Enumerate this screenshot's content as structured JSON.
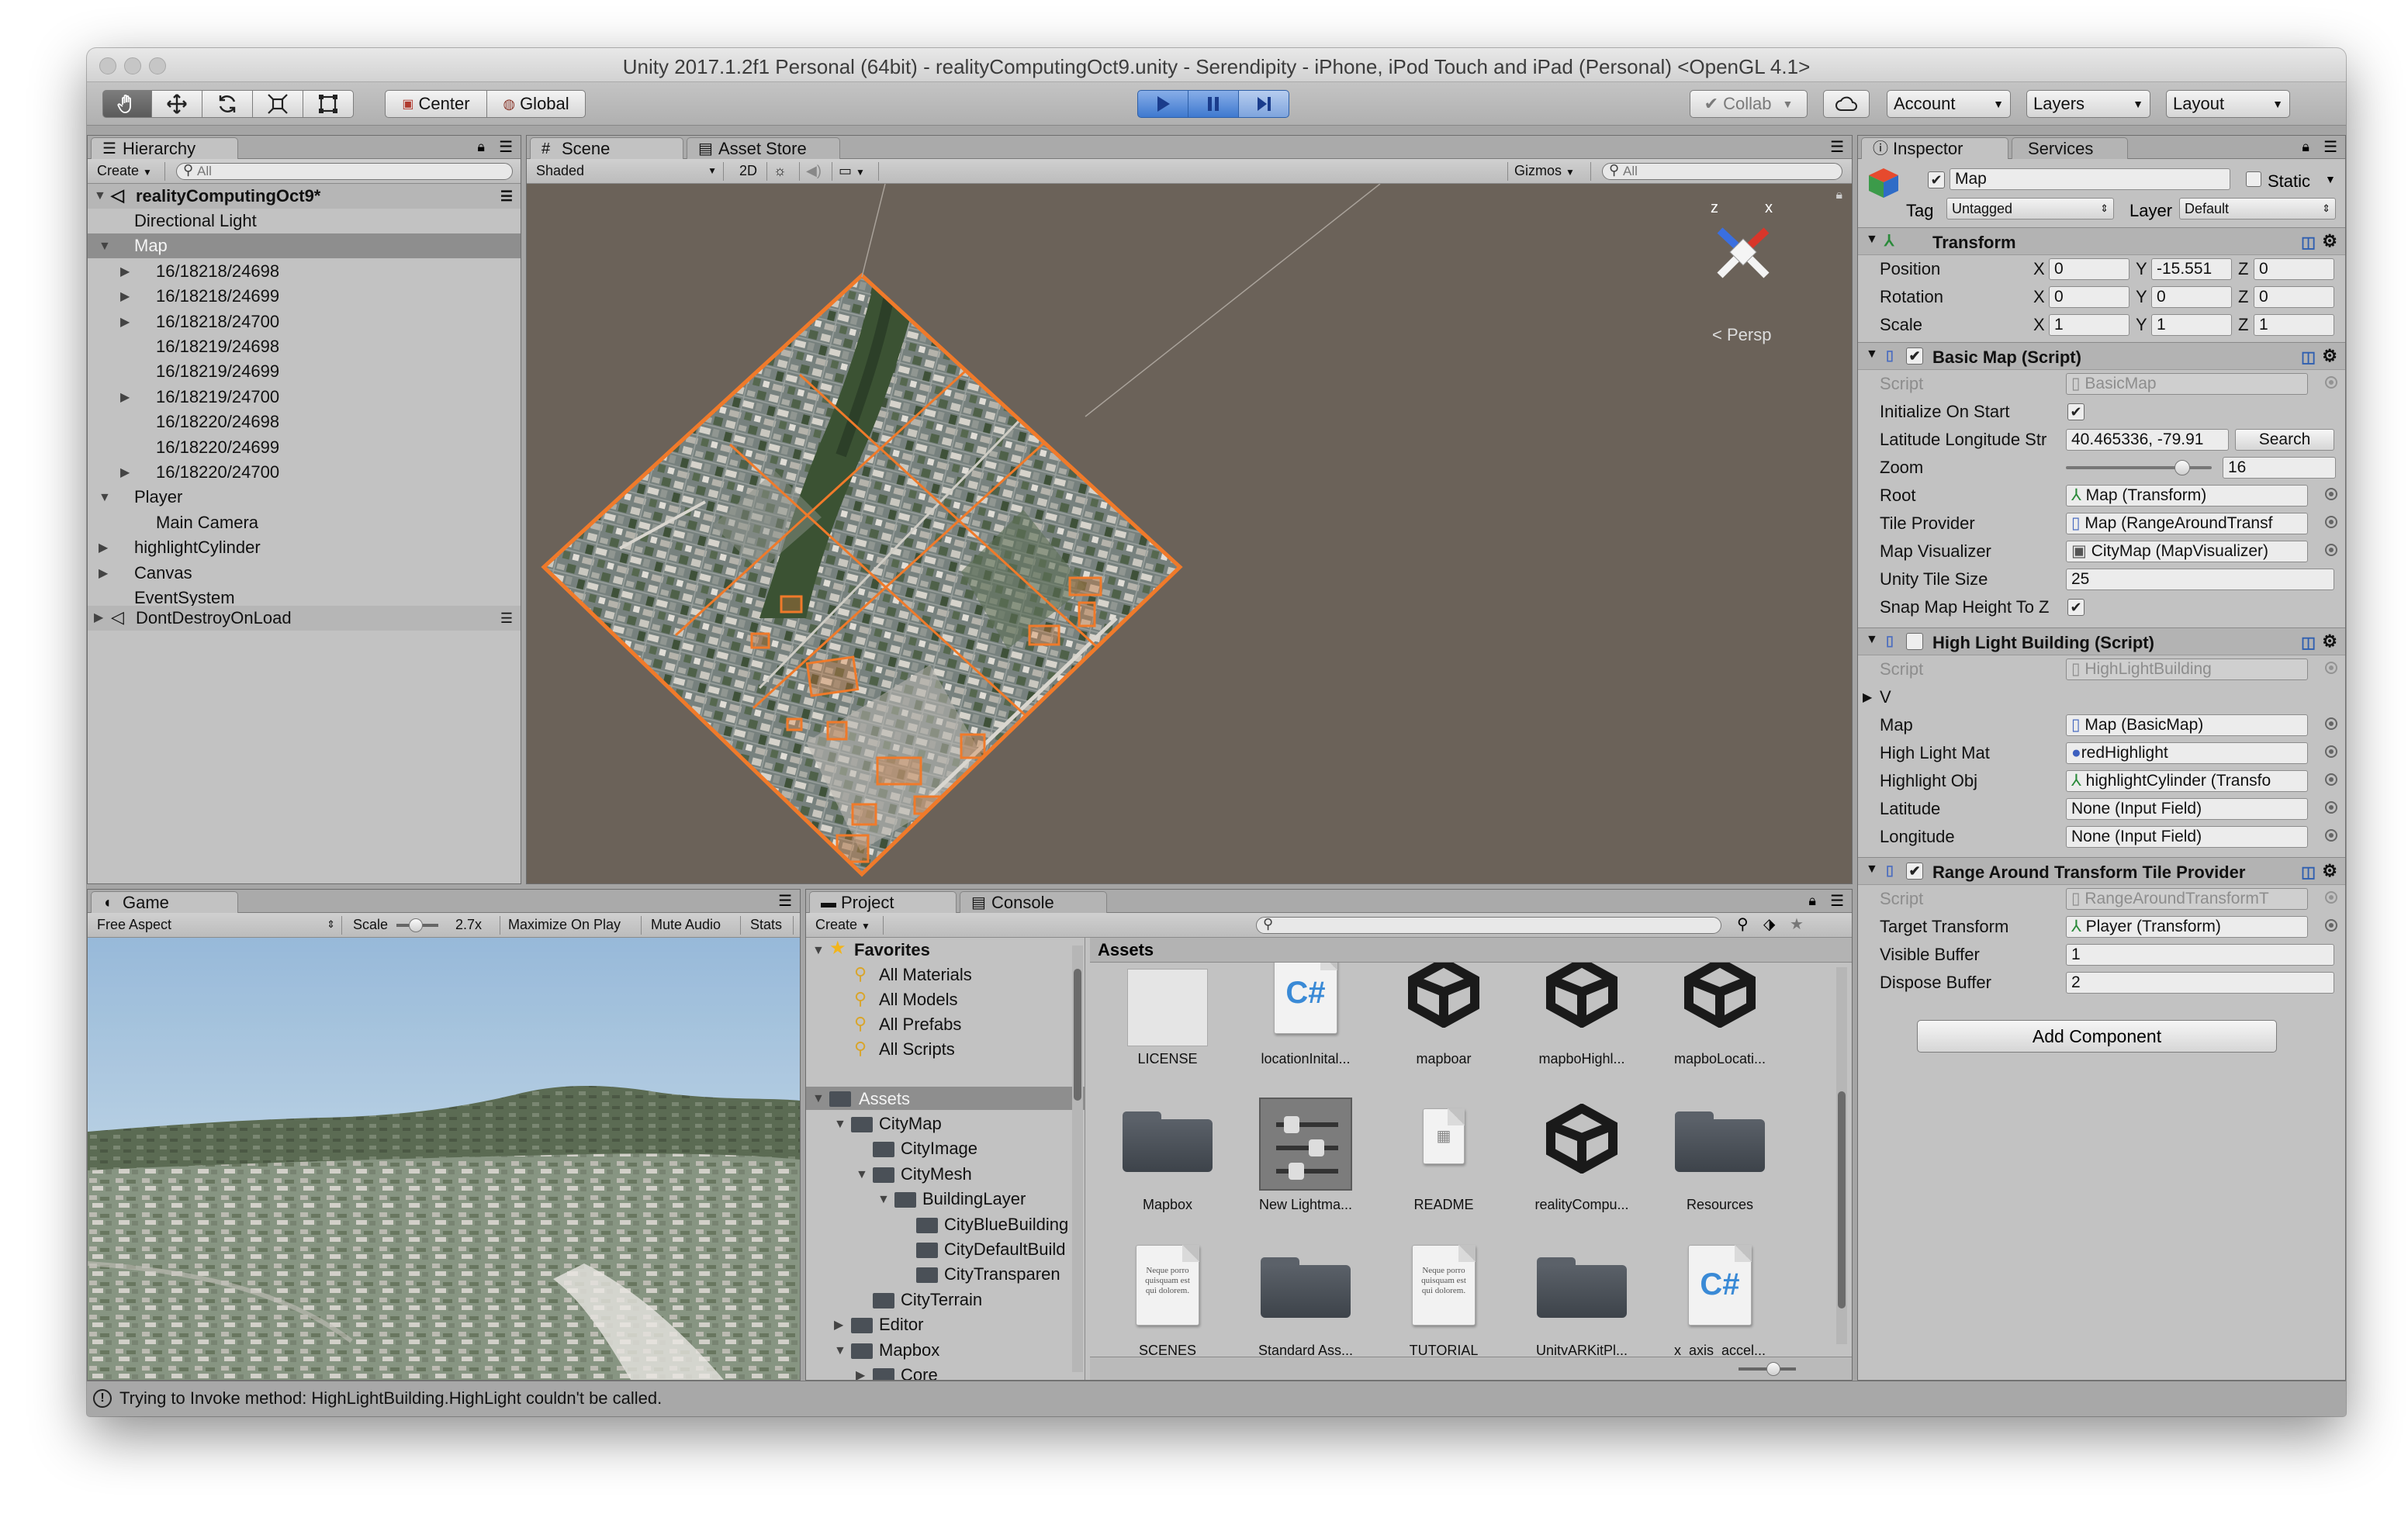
{
  "window": {
    "title": "Unity 2017.1.2f1 Personal (64bit) - realityComputingOct9.unity - Serendipity - iPhone, iPod Touch and iPad (Personal) <OpenGL 4.1>"
  },
  "toolbar": {
    "pivot_label": "Center",
    "rotation_label": "Global",
    "collab_label": "Collab",
    "account_label": "Account",
    "layers_label": "Layers",
    "layout_label": "Layout"
  },
  "hierarchy": {
    "tab_label": "Hierarchy",
    "create_label": "Create",
    "search_placeholder": "All",
    "scene_name": "realityComputingOct9*",
    "items": [
      {
        "label": "Directional Light"
      },
      {
        "label": "Map"
      },
      {
        "label": "16/18218/24698"
      },
      {
        "label": "16/18218/24699"
      },
      {
        "label": "16/18218/24700"
      },
      {
        "label": "16/18219/24698"
      },
      {
        "label": "16/18219/24699"
      },
      {
        "label": "16/18219/24700"
      },
      {
        "label": "16/18220/24698"
      },
      {
        "label": "16/18220/24699"
      },
      {
        "label": "16/18220/24700"
      },
      {
        "label": "Player"
      },
      {
        "label": "Main Camera"
      },
      {
        "label": "highlightCylinder"
      },
      {
        "label": "Canvas"
      },
      {
        "label": "EventSystem"
      }
    ],
    "ddol_label": "DontDestroyOnLoad"
  },
  "scene": {
    "tab_label": "Scene",
    "asset_store_label": "Asset Store",
    "shading_label": "Shaded",
    "mode_2d": "2D",
    "gizmos_label": "Gizmos",
    "search_placeholder": "All",
    "gizmo_x": "x",
    "gizmo_z": "z",
    "persp_label": "Persp"
  },
  "game": {
    "tab_label": "Game",
    "aspect_label": "Free Aspect",
    "scale_label": "Scale",
    "scale_value": "2.7x",
    "maximize_label": "Maximize On Play",
    "mute_label": "Mute Audio",
    "stats_label": "Stats"
  },
  "project": {
    "tab_label": "Project",
    "console_tab_label": "Console",
    "create_label": "Create",
    "favorites_label": "Favorites",
    "favorites": [
      "All Materials",
      "All Models",
      "All Prefabs",
      "All Scripts"
    ],
    "assets_label": "Assets",
    "tree": [
      "CityMap",
      "CityImage",
      "CityMesh",
      "BuildingLayer",
      "CityBlueBuilding",
      "CityDefaultBuild",
      "CityTransparen",
      "CityTerrain",
      "Editor",
      "Mapbox",
      "Core"
    ],
    "assets_header": "Assets",
    "assets": [
      {
        "label": "LICENSE",
        "kind": "doc"
      },
      {
        "label": "locationInital...",
        "kind": "script"
      },
      {
        "label": "mapboar",
        "kind": "unity"
      },
      {
        "label": "mapboHighl...",
        "kind": "unity"
      },
      {
        "label": "mapboLocati...",
        "kind": "unity"
      },
      {
        "label": "Mapbox",
        "kind": "folder"
      },
      {
        "label": "New Lightma...",
        "kind": "lightmap"
      },
      {
        "label": "README",
        "kind": "readme"
      },
      {
        "label": "realityCompu...",
        "kind": "unity"
      },
      {
        "label": "Resources",
        "kind": "folder"
      },
      {
        "label": "SCENES",
        "kind": "text"
      },
      {
        "label": "Standard Ass...",
        "kind": "folder"
      },
      {
        "label": "TUTORIAL",
        "kind": "text"
      },
      {
        "label": "UnityARKitPl...",
        "kind": "folder"
      },
      {
        "label": "x_axis_accel...",
        "kind": "script"
      }
    ],
    "doc_preview_text": "Neque porro quisquam est qui dolorem."
  },
  "inspector": {
    "tab_label": "Inspector",
    "services_label": "Services",
    "object_name": "Map",
    "static_label": "Static",
    "tag_label": "Tag",
    "tag_value": "Untagged",
    "layer_label": "Layer",
    "layer_value": "Default",
    "transform": {
      "title": "Transform",
      "position_label": "Position",
      "position": [
        "0",
        "-15.551",
        "0"
      ],
      "rotation_label": "Rotation",
      "rotation": [
        "0",
        "0",
        "0"
      ],
      "scale_label": "Scale",
      "scale": [
        "1",
        "1",
        "1"
      ],
      "axes": [
        "X",
        "Y",
        "Z"
      ]
    },
    "basic_map": {
      "title": "Basic Map (Script)",
      "script_label": "Script",
      "script_value": "BasicMap",
      "init_label": "Initialize On Start",
      "latlon_label": "Latitude Longitude Str",
      "latlon_value": "40.465336, -79.91",
      "search_label": "Search",
      "zoom_label": "Zoom",
      "zoom_value": "16",
      "zoom_slider": 0.8,
      "root_label": "Root",
      "root_value": "Map (Transform)",
      "tile_label": "Tile Provider",
      "tile_value": "Map (RangeAroundTransf",
      "vis_label": "Map Visualizer",
      "vis_value": "CityMap (MapVisualizer)",
      "tile_size_label": "Unity Tile Size",
      "tile_size_value": "25",
      "snap_label": "Snap Map Height To Z"
    },
    "highlight": {
      "title": "High Light Building (Script)",
      "script_label": "Script",
      "script_value": "HighLightBuilding",
      "v_label": "V",
      "map_label": "Map",
      "map_value": "Map (BasicMap)",
      "mat_label": "High Light Mat",
      "mat_value": "redHighlight",
      "obj_label": "Highlight Obj",
      "obj_value": "highlightCylinder (Transfo",
      "lat_label": "Latitude",
      "lat_value": "None (Input Field)",
      "lon_label": "Longitude",
      "lon_value": "None (Input Field)"
    },
    "range": {
      "title": "Range Around Transform Tile Provider",
      "script_label": "Script",
      "script_value": "RangeAroundTransformT",
      "target_label": "Target Transform",
      "target_value": "Player (Transform)",
      "visible_label": "Visible Buffer",
      "visible_value": "1",
      "dispose_label": "Dispose Buffer",
      "dispose_value": "2"
    },
    "add_component_label": "Add Component"
  },
  "status": {
    "message": "Trying to Invoke method: HighLightBuilding.HighLight couldn't be called."
  },
  "colors": {
    "play_blue": "#3e79cf",
    "tile_outline": "#f07a2a",
    "scene_bg": "#6b6259"
  }
}
